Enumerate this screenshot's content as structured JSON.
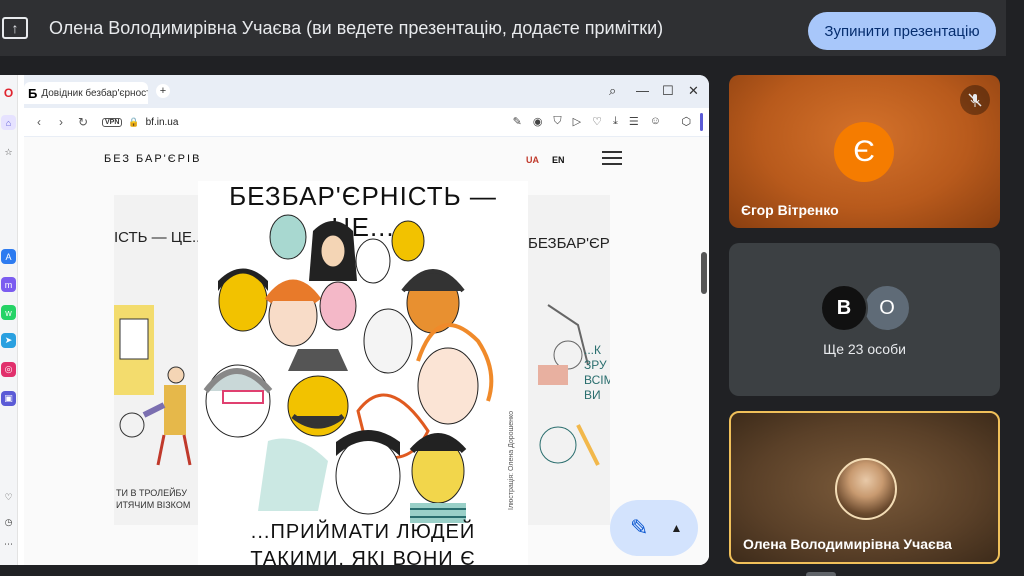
{
  "topbar": {
    "present_icon": "present-to-all-icon",
    "title": "Олена Володимирівна Учаєва (ви ведете презентацію, додаєте примітки)",
    "stop_label": "Зупинити презентацію"
  },
  "browser": {
    "tab_favicon": "Б",
    "tab_title": "Довідник безбар'єрності",
    "new_tab": "+",
    "vpn": "VPN",
    "url": "bf.in.ua"
  },
  "site": {
    "logo": "БЕЗ БАР'ЄРІВ",
    "lang_ua": "UA",
    "lang_en": "EN",
    "poster_title": "БЕЗБАР'ЄРНІСТЬ — ЦЕ...",
    "poster_bottom_line1": "...ПРИЙМАТИ ЛЮДЕЙ",
    "poster_bottom_line2": "ТАКИМИ, ЯКІ ВОНИ Є",
    "left_poster_title": "ІСТЬ — ЦЕ...",
    "left_poster_caption_line1": "ТИ В ТРОЛЕЙБУ",
    "left_poster_caption_line2": "ИТЯЧИМ ВІЗКОМ",
    "right_poster_title": "БЕЗБАР'ЄР",
    "right_poster_text": "...К\nЗРУ\nВСІМ\nВИ",
    "credit": "Ілюстрація: Олена Дорошенко"
  },
  "participants": [
    {
      "name": "Єгор Вітренко",
      "initial": "Є",
      "avatar_color": "#f57c00",
      "muted": true
    },
    {
      "more_label": "Ще 23 особи",
      "initials": [
        "В",
        "О"
      ]
    },
    {
      "name": "Олена Володимирівна Учаєва"
    }
  ],
  "colors": {
    "accent": "#a8c7fa",
    "active_speaker_border": "#f0c05a"
  }
}
